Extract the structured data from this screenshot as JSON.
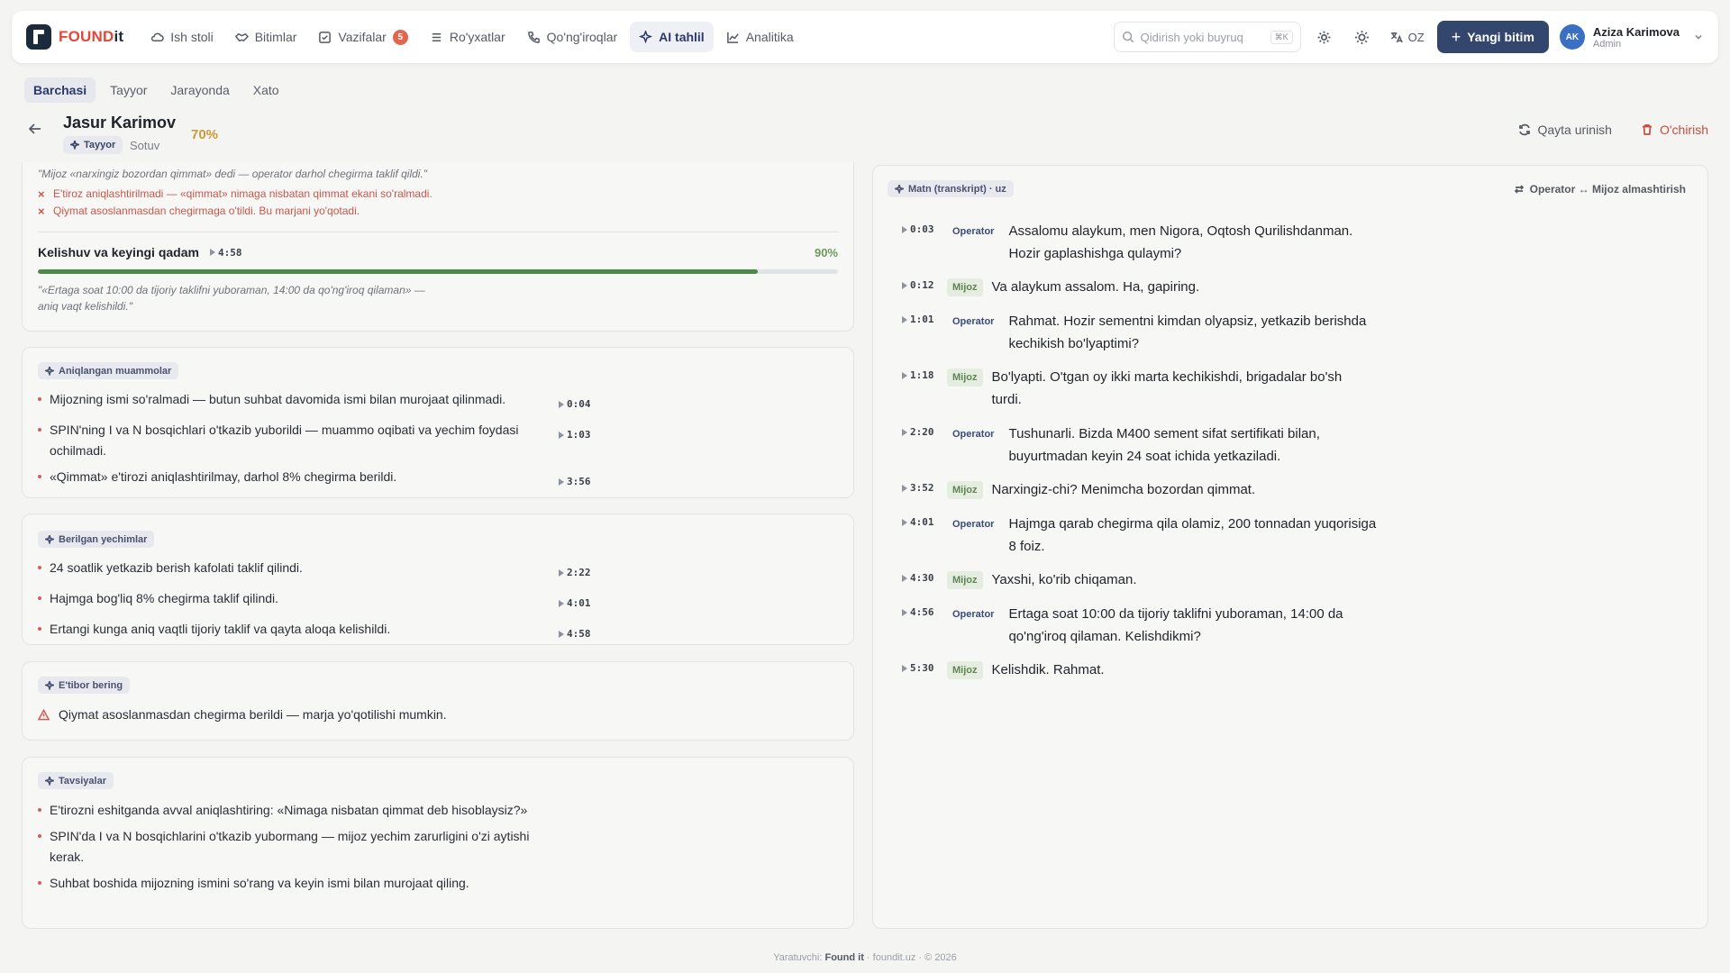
{
  "app": {
    "logo_a": "FOUND",
    "logo_b": "it"
  },
  "nav": {
    "items": [
      {
        "label": "Ish stoli",
        "icon": "cloud-icon"
      },
      {
        "label": "Bitimlar",
        "icon": "handshake-icon"
      },
      {
        "label": "Vazifalar",
        "icon": "checkbox-icon",
        "badge": "5"
      },
      {
        "label": "Ro'yxatlar",
        "icon": "list-icon"
      },
      {
        "label": "Qo'ng'iroqlar",
        "icon": "phone-icon"
      },
      {
        "label": "AI tahlil",
        "icon": "sparkle-icon",
        "active": true
      },
      {
        "label": "Analitika",
        "icon": "chart-icon"
      }
    ],
    "search_placeholder": "Qidirish yoki buyruq",
    "search_kbd": "⌘K",
    "lang": "OZ",
    "new_deal": "Yangi bitim",
    "user": {
      "initials": "AK",
      "name": "Aziza Karimova",
      "role": "Admin"
    }
  },
  "tabs": [
    "Barchasi",
    "Tayyor",
    "Jarayonda",
    "Xato"
  ],
  "detail": {
    "name": "Jasur Karimov",
    "status": "Tayyor",
    "dept": "Sotuv",
    "score": "70%",
    "retry": "Qayta urinish",
    "delete": "O'chirish"
  },
  "card1": {
    "quote_top": "\"Mijoz «narxingiz bozordan qimmat» dedi — operator darhol chegirma taklif qildi.\"",
    "misses": [
      "E'tiroz aniqlashtirilmadi — «qimmat» nimaga nisbatan qimmat ekani so'ralmadi.",
      "Qiymat asoslanmasdan chegirmaga o'tildi. Bu marjani yo'qotadi."
    ],
    "step_title": "Kelishuv va keyingi qadam",
    "step_ts": "4:58",
    "step_pct": "90%",
    "step_progress": 0.9,
    "step_quote_1": "\"«Ertaga soat 10:00 da tijoriy taklifni yuboraman, 14:00 da qo'ng'iroq qilaman» —",
    "step_quote_2": "aniq vaqt kelishildi.\""
  },
  "problems": {
    "label": "Aniqlangan muammolar",
    "items": [
      {
        "text": "Mijozning ismi so'ralmadi — butun suhbat davomida ismi bilan murojaat qilinmadi.",
        "ts": "0:04"
      },
      {
        "text": "SPIN'ning I va N bosqichlari o'tkazib yuborildi — muammo oqibati va yechim foydasi ochilmadi.",
        "ts": "1:03"
      },
      {
        "text": "«Qimmat» e'tirozi aniqlashtirilmay, darhol 8% chegirma berildi.",
        "ts": "3:56"
      }
    ]
  },
  "solutions": {
    "label": "Berilgan yechimlar",
    "items": [
      {
        "text": "24 soatlik yetkazib berish kafolati taklif qilindi.",
        "ts": "2:22"
      },
      {
        "text": "Hajmga bog'liq 8% chegirma taklif qilindi.",
        "ts": "4:01"
      },
      {
        "text": "Ertangi kunga aniq vaqtli tijoriy taklif va qayta aloqa kelishildi.",
        "ts": "4:58"
      }
    ]
  },
  "attention": {
    "label": "E'tibor bering",
    "text": "Qiymat asoslanmasdan chegirma berildi — marja yo'qotilishi mumkin."
  },
  "recommendations": {
    "label": "Tavsiyalar",
    "items": [
      "E'tirozni eshitganda avval aniqlashtiring: «Nimaga nisbatan qimmat deb hisoblaysiz?»",
      "SPIN'da I va N bosqichlarini o'tkazib yubormang — mijoz yechim zarurligini o'zi aytishi kerak.",
      "Suhbat boshida mijozning ismini so'rang va keyin ismi bilan murojaat qiling."
    ]
  },
  "transcript": {
    "label": "Matn (transkript) · uz",
    "swap": "Operator ↔ Mijoz almashtirish",
    "messages": [
      {
        "ts": "0:03",
        "speaker": "Operator",
        "text": "Assalomu alaykum, men Nigora, Oqtosh Qurilishdanman. Hozir gaplashishga qulaymi?"
      },
      {
        "ts": "0:12",
        "speaker": "Mijoz",
        "text": "Va alaykum assalom. Ha, gapiring."
      },
      {
        "ts": "1:01",
        "speaker": "Operator",
        "text": "Rahmat. Hozir sementni kimdan olyapsiz, yetkazib berishda kechikish bo'lyaptimi?"
      },
      {
        "ts": "1:18",
        "speaker": "Mijoz",
        "text": "Bo'lyapti. O'tgan oy ikki marta kechikishdi, brigadalar bo'sh turdi."
      },
      {
        "ts": "2:20",
        "speaker": "Operator",
        "text": "Tushunarli. Bizda M400 sement sifat sertifikati bilan, buyurtmadan keyin 24 soat ichida yetkaziladi."
      },
      {
        "ts": "3:52",
        "speaker": "Mijoz",
        "text": "Narxingiz-chi? Menimcha bozordan qimmat."
      },
      {
        "ts": "4:01",
        "speaker": "Operator",
        "text": "Hajmga qarab chegirma qila olamiz, 200 tonnadan yuqorisiga 8 foiz."
      },
      {
        "ts": "4:30",
        "speaker": "Mijoz",
        "text": "Yaxshi, ko'rib chiqaman."
      },
      {
        "ts": "4:56",
        "speaker": "Operator",
        "text": "Ertaga soat 10:00 da tijoriy taklifni yuboraman, 14:00 da qo'ng'iroq qilaman. Kelishdikmi?"
      },
      {
        "ts": "5:30",
        "speaker": "Mijoz",
        "text": "Kelishdik. Rahmat."
      }
    ]
  },
  "footer": {
    "prefix": "Yaratuvchi:",
    "brand": "Found it",
    "site": "foundit.uz",
    "year": "© 2026"
  },
  "colors": {
    "primary": "#32466e",
    "danger": "#c94a3e",
    "score": "#c99a3a",
    "progress": "#4d8a4a"
  }
}
